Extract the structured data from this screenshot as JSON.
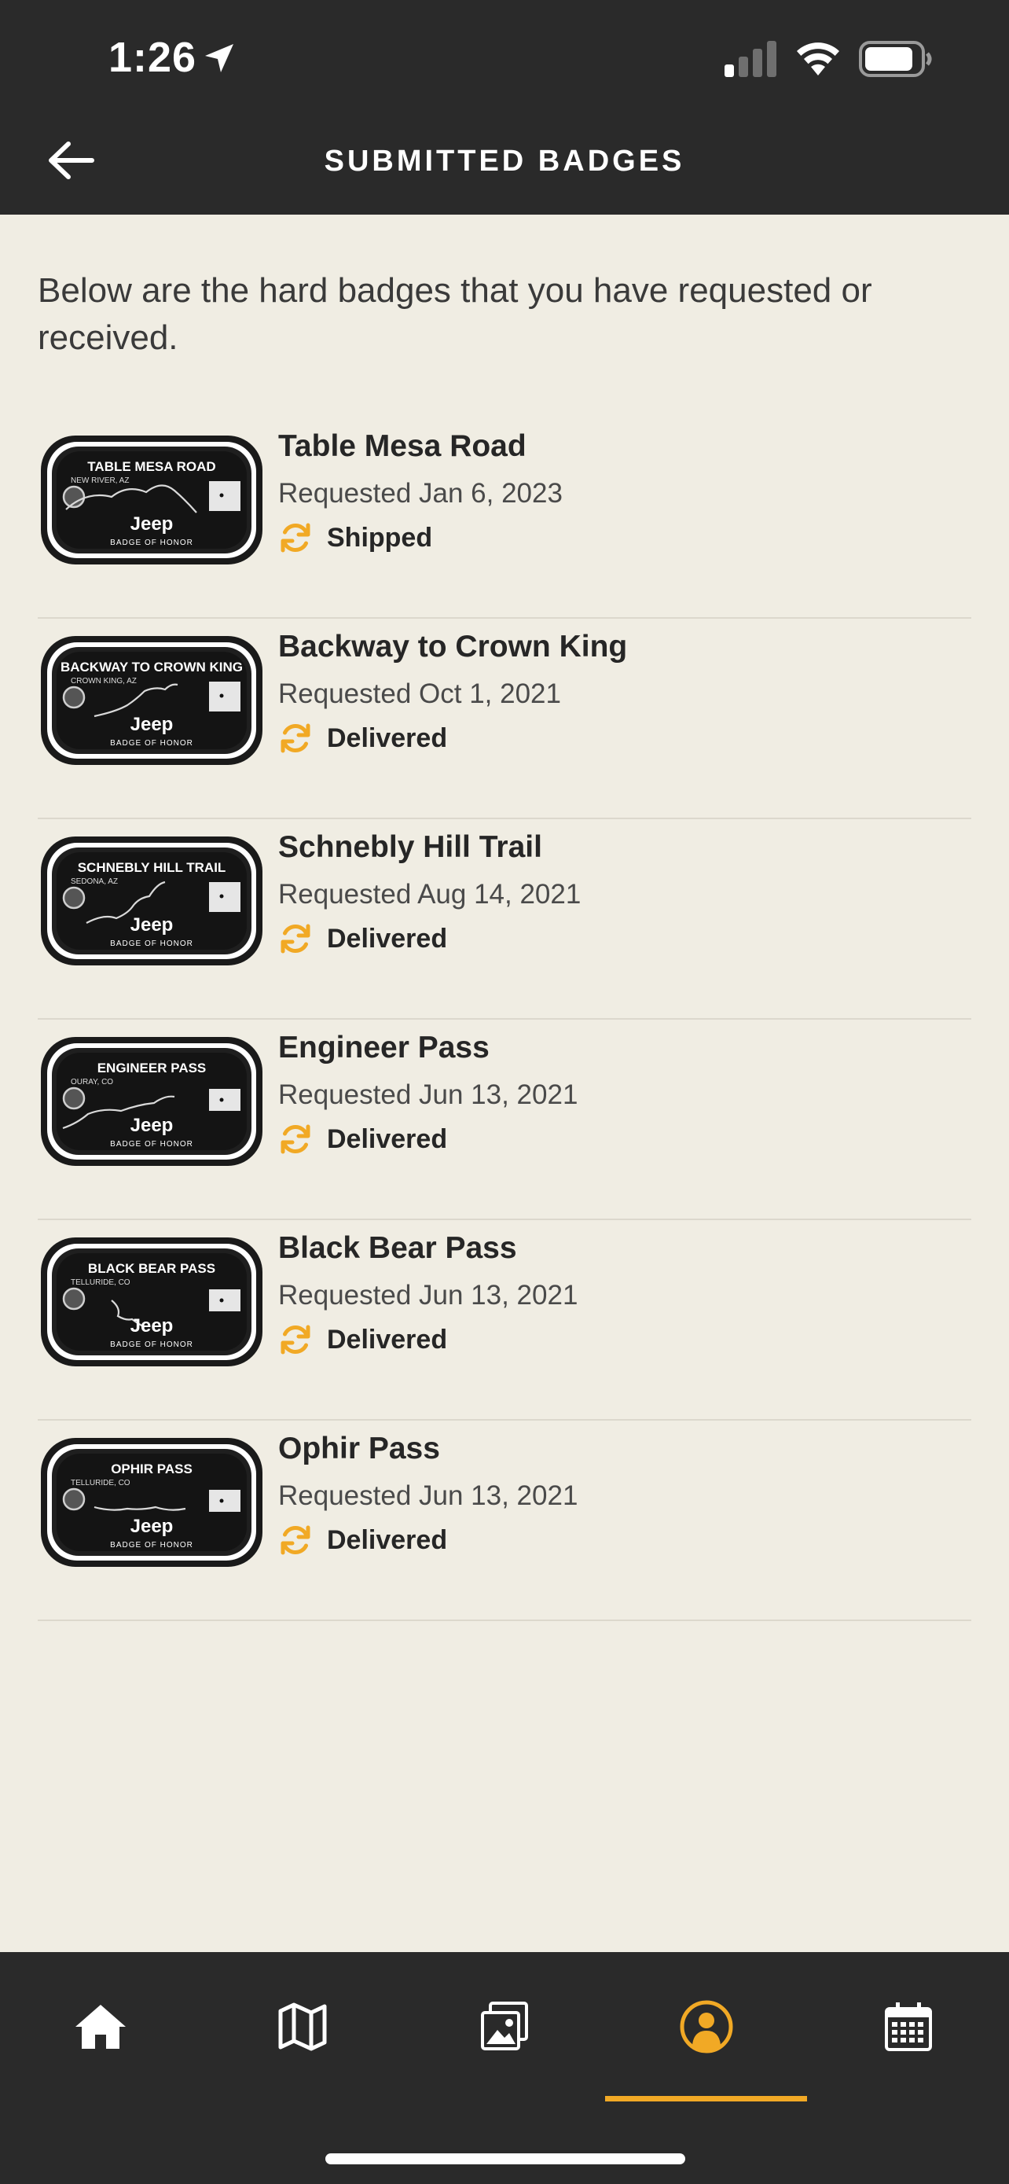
{
  "status_bar": {
    "time": "1:26"
  },
  "header": {
    "title": "SUBMITTED BADGES"
  },
  "intro": "Below are the hard badges that you have requested or received.",
  "badges": [
    {
      "name": "Table Mesa Road",
      "date": "Requested Jan 6, 2023",
      "status": "Shipped",
      "plate_title": "TABLE MESA ROAD",
      "plate_location": "NEW RIVER, AZ",
      "plate_brand": "Jeep",
      "plate_footer": "BADGE OF HONOR"
    },
    {
      "name": "Backway to Crown King",
      "date": "Requested Oct 1, 2021",
      "status": "Delivered",
      "plate_title": "BACKWAY TO CROWN KING",
      "plate_location": "CROWN KING, AZ",
      "plate_brand": "Jeep",
      "plate_footer": "BADGE OF HONOR"
    },
    {
      "name": "Schnebly Hill Trail",
      "date": "Requested Aug 14, 2021",
      "status": "Delivered",
      "plate_title": "SCHNEBLY HILL TRAIL",
      "plate_location": "SEDONA, AZ",
      "plate_brand": "Jeep",
      "plate_footer": "BADGE OF HONOR"
    },
    {
      "name": "Engineer Pass",
      "date": "Requested Jun 13, 2021",
      "status": "Delivered",
      "plate_title": "ENGINEER PASS",
      "plate_location": "OURAY, CO",
      "plate_brand": "Jeep",
      "plate_footer": "BADGE OF HONOR"
    },
    {
      "name": "Black Bear Pass",
      "date": "Requested Jun 13, 2021",
      "status": "Delivered",
      "plate_title": "BLACK BEAR PASS",
      "plate_location": "TELLURIDE, CO",
      "plate_brand": "Jeep",
      "plate_footer": "BADGE OF HONOR"
    },
    {
      "name": "Ophir Pass",
      "date": "Requested Jun 13, 2021",
      "status": "Delivered",
      "plate_title": "OPHIR PASS",
      "plate_location": "TELLURIDE, CO",
      "plate_brand": "Jeep",
      "plate_footer": "BADGE OF HONOR"
    }
  ],
  "nav": [
    {
      "icon": "home-icon",
      "active": false
    },
    {
      "icon": "map-icon",
      "active": false
    },
    {
      "icon": "gallery-icon",
      "active": false
    },
    {
      "icon": "profile-icon",
      "active": true
    },
    {
      "icon": "calendar-icon",
      "active": false
    }
  ],
  "colors": {
    "accent": "#f1a925",
    "bar": "#2a2a2a",
    "background": "#f0ede3"
  }
}
